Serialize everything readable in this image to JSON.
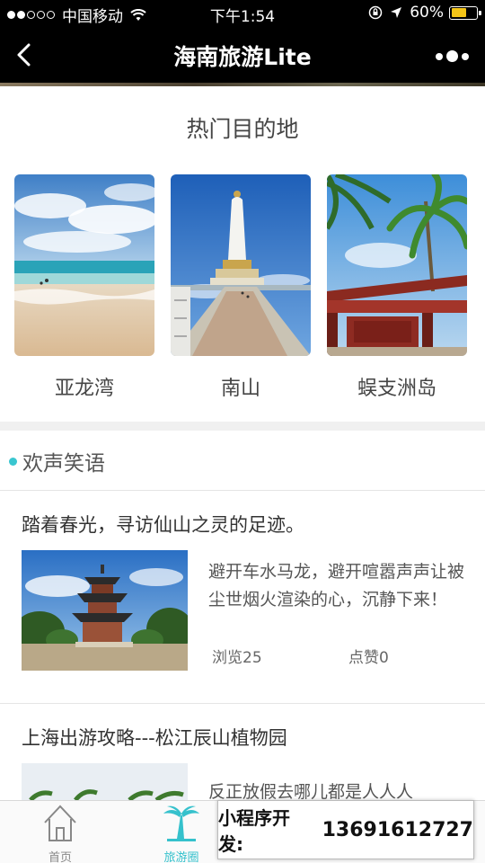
{
  "status_bar": {
    "carrier": "中国移动",
    "time": "下午1:54",
    "battery_percent": "60%",
    "battery_level": 0.6,
    "signal_full": 2,
    "signal_empty": 3
  },
  "nav": {
    "title": "海南旅游Lite"
  },
  "hot": {
    "title": "热门目的地",
    "destinations": [
      {
        "name": "亚龙湾",
        "image": "beach-photo"
      },
      {
        "name": "南山",
        "image": "statue-photo"
      },
      {
        "name": "蜈支洲岛",
        "image": "pavilion-palm-photo"
      }
    ]
  },
  "section": {
    "title": "欢声笑语"
  },
  "posts": [
    {
      "title": "踏着春光，寻访仙山之灵的足迹。",
      "text": "避开车水马龙，避开喧嚣声声让被尘世烟火渲染的心，沉静下来！",
      "views": "浏览25",
      "likes": "点赞0",
      "image": "pagoda-photo"
    },
    {
      "title": "上海出游攻略---松江辰山植物园",
      "text": "反正放假去哪儿都是人人人",
      "image": "palm-garden-photo"
    }
  ],
  "tabs": [
    {
      "label": "首页",
      "icon": "home-icon",
      "active": false
    },
    {
      "label": "旅游圈",
      "icon": "palm-tree-icon",
      "active": true
    }
  ],
  "promo": {
    "label": "小程序开发:",
    "phone": "13691612727"
  },
  "colors": {
    "accent": "#39c6d0",
    "battery": "#f5c518"
  }
}
